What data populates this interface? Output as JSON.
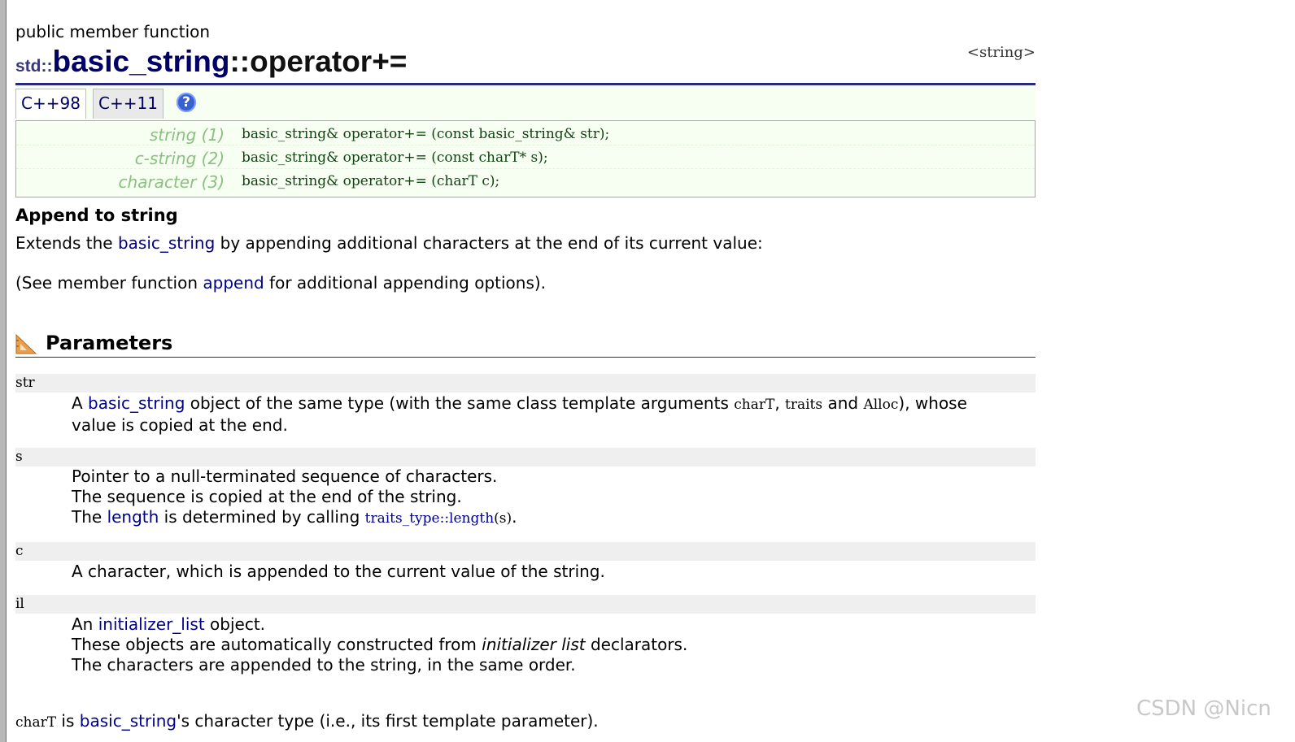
{
  "header": {
    "kind": "public member function",
    "namespace": "std::",
    "class_name": "basic_string",
    "op_name": "::operator+=",
    "header_tag": "<string>"
  },
  "tabs": [
    {
      "label": "C++98",
      "active": true
    },
    {
      "label": "C++11",
      "active": false
    }
  ],
  "help_icon_text": "?",
  "declarations": [
    {
      "label": "string (1)",
      "code": "basic_string& operator+= (const basic_string& str);"
    },
    {
      "label": "c-string (2)",
      "code": "basic_string& operator+= (const charT* s);"
    },
    {
      "label": "character (3)",
      "code": "basic_string& operator+= (charT c);"
    }
  ],
  "summary": {
    "heading": "Append to string",
    "p1_before": "Extends the ",
    "p1_link": "basic_string",
    "p1_after": " by appending additional characters at the end of its current value:",
    "p2_before": "(See member function ",
    "p2_link": "append",
    "p2_after": " for additional appending options)."
  },
  "parameters": {
    "heading": "Parameters",
    "str": {
      "name": "str",
      "l1_a": "A ",
      "l1_link": "basic_string",
      "l1_b": " object of the same type (with the same class template arguments ",
      "l1_code1": "charT",
      "l1_c": ", ",
      "l1_code2": "traits",
      "l1_d": " and ",
      "l1_code3": "Alloc",
      "l1_e": "), whose",
      "l2": "value is copied at the end."
    },
    "s": {
      "name": "s",
      "l1": "Pointer to a null-terminated sequence of characters.",
      "l2": "The sequence is copied at the end of the string.",
      "l3_a": "The ",
      "l3_link": "length",
      "l3_b": " is determined by calling ",
      "l3_code_link": "traits_type::length",
      "l3_code": "(s)",
      "l3_c": "."
    },
    "c": {
      "name": "c",
      "l1": "A character, which is appended to the current value of the string."
    },
    "il": {
      "name": "il",
      "l1_a": "An ",
      "l1_link": "initializer_list",
      "l1_b": " object.",
      "l2_a": "These objects are automatically constructed from ",
      "l2_em": "initializer list",
      "l2_b": " declarators.",
      "l3": "The characters are appended to the string, in the same order."
    }
  },
  "footer": {
    "code": "charT",
    "a": " is ",
    "link": "basic_string",
    "b": "'s character type (i.e., its first template parameter)."
  },
  "watermark": "CSDN @Nicn",
  "colors": {
    "link": "#000088",
    "title_rule": "#2a2a7a",
    "decl_bg": "#f7fff3",
    "decl_label": "#8bc080",
    "param_bg": "#efefef"
  }
}
